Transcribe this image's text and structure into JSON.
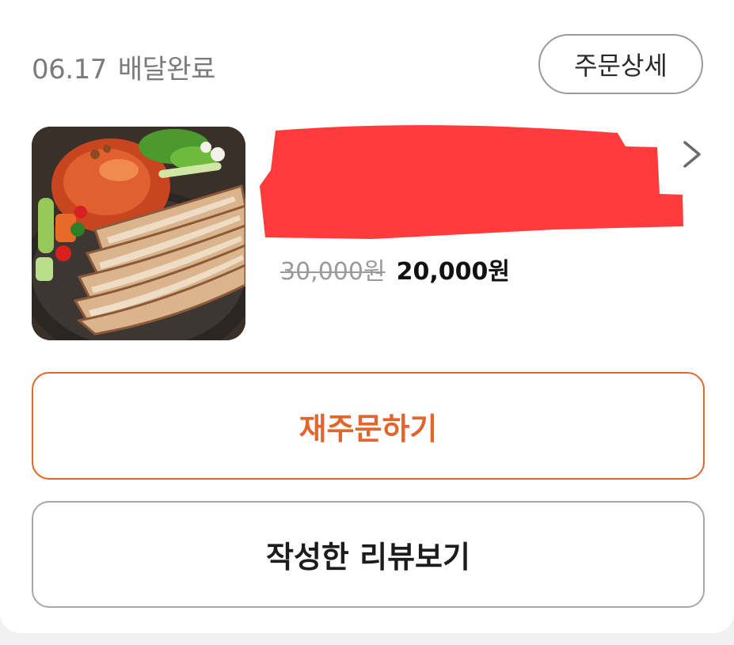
{
  "order": {
    "date": "06.17",
    "status": "배달완료",
    "detail_button_label": "주문상세"
  },
  "product": {
    "image_icon": "bossam-food-photo",
    "name_redacted": true,
    "original_price": "30,000원",
    "sale_price": "20,000원"
  },
  "actions": {
    "reorder_label": "재주문하기",
    "review_label": "작성한 리뷰보기"
  },
  "colors": {
    "accent": "#e0662e",
    "redaction": "#ff3b3b",
    "muted_text": "#7b7b7b"
  }
}
